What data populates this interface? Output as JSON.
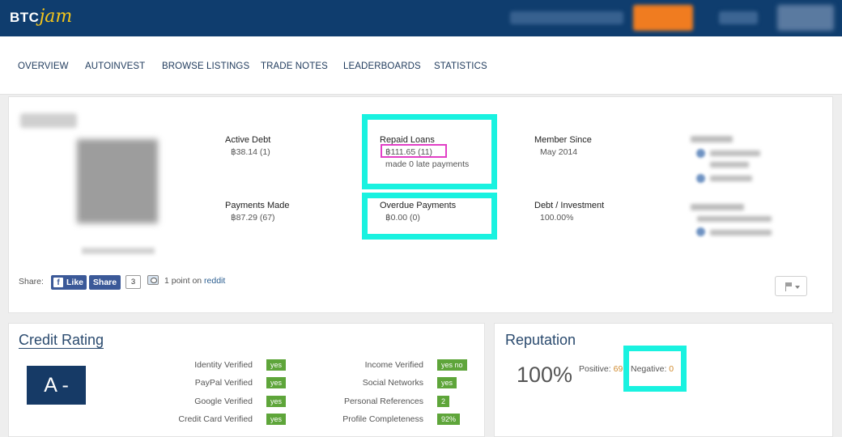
{
  "brand": {
    "logo_prefix": "BTC",
    "logo_suffix": "jam"
  },
  "subnav": [
    "OVERVIEW",
    "AUTOINVEST",
    "BROWSE LISTINGS",
    "TRADE NOTES",
    "LEADERBOARDS",
    "STATISTICS"
  ],
  "profile": {
    "active_debt": {
      "label": "Active Debt",
      "value": "฿38.14 (1)"
    },
    "repaid_loans": {
      "label": "Repaid Loans",
      "value": "฿111.65 (11)",
      "note": "made 0 late payments"
    },
    "member_since": {
      "label": "Member Since",
      "value": "May 2014"
    },
    "payments_made": {
      "label": "Payments Made",
      "value": "฿87.29 (67)"
    },
    "overdue_payments": {
      "label": "Overdue Payments",
      "value": "฿0.00 (0)"
    },
    "debt_investment": {
      "label": "Debt / Investment",
      "value": "100.00%"
    }
  },
  "share": {
    "label": "Share:",
    "like_label": "Like",
    "like_icon": "f",
    "share_label": "Share",
    "count": "3",
    "reddit_text": "1 point on",
    "reddit_link": "reddit"
  },
  "credit_rating": {
    "title": "Credit Rating",
    "grade": "A -",
    "left": [
      {
        "label": "Identity Verified",
        "badge": "yes"
      },
      {
        "label": "PayPal Verified",
        "badge": "yes"
      },
      {
        "label": "Google Verified",
        "badge": "yes"
      },
      {
        "label": "Credit Card Verified",
        "badge": "yes"
      }
    ],
    "right": [
      {
        "label": "Income Verified",
        "badge": "yes no"
      },
      {
        "label": "Social Networks",
        "badge": "yes"
      },
      {
        "label": "Personal References",
        "badge": "2"
      },
      {
        "label": "Profile Completeness",
        "badge": "92%"
      }
    ]
  },
  "reputation": {
    "title": "Reputation",
    "percent": "100%",
    "positive_label": "Positive:",
    "positive_value": "69",
    "negative_label": "Negative:",
    "negative_value": "0"
  },
  "colors": {
    "header_bg": "#0f3d6e",
    "highlight_cyan": "#19f2e0",
    "highlight_pink": "#e23fc6",
    "badge_green": "#5ea53a",
    "grade_bg": "#163a66"
  }
}
